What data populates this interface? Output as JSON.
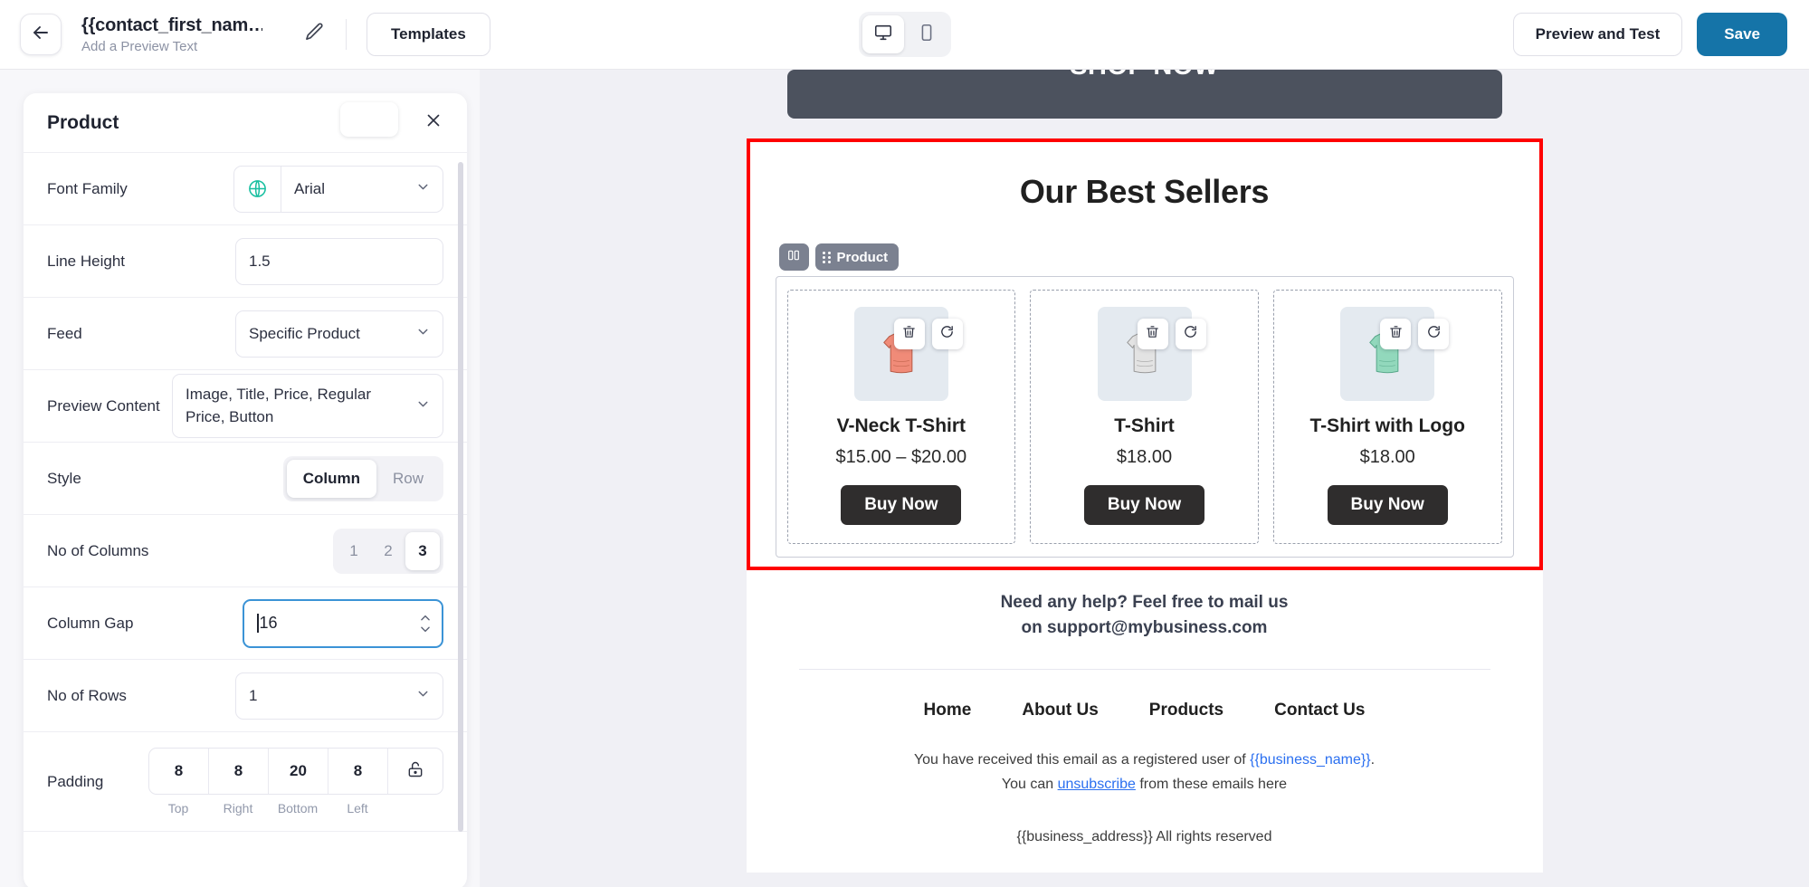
{
  "topbar": {
    "back_icon": "arrow-left-icon",
    "subject": "{{contact_first_nam…",
    "preview_text": "Add a Preview Text",
    "edit_icon": "pencil-icon",
    "templates_label": "Templates",
    "desktop_icon": "desktop-icon",
    "mobile_icon": "mobile-icon",
    "preview_label": "Preview and Test",
    "save_label": "Save",
    "save_color": "#1574a8"
  },
  "panel": {
    "title": "Product",
    "close_icon": "close-icon",
    "rows": {
      "font_family": {
        "label": "Font Family",
        "icon": "globe-icon",
        "value": "Arial"
      },
      "line_height": {
        "label": "Line Height",
        "value": "1.5"
      },
      "feed": {
        "label": "Feed",
        "value": "Specific Product"
      },
      "preview_content": {
        "label": "Preview Content",
        "value": "Image, Title, Price, Regular Price, Button"
      },
      "style": {
        "label": "Style",
        "options": [
          "Column",
          "Row"
        ],
        "selected": "Column"
      },
      "no_of_columns": {
        "label": "No of Columns",
        "options": [
          "1",
          "2",
          "3"
        ],
        "selected": "3"
      },
      "column_gap": {
        "label": "Column Gap",
        "value": "16"
      },
      "no_of_rows": {
        "label": "No of Rows",
        "value": "1"
      },
      "padding": {
        "label": "Padding",
        "values": [
          "8",
          "8",
          "20",
          "8"
        ],
        "labels": [
          "Top",
          "Right",
          "Bottom",
          "Left"
        ],
        "lock_icon": "unlock-icon"
      }
    }
  },
  "email": {
    "hero_button": "SHOP NOW",
    "section_title": "Our Best Sellers",
    "block_badge": "Product",
    "block_columns_icon": "columns-icon",
    "block_drag_icon": "drag-handle-icon",
    "selection_color": "#ff0000",
    "products": [
      {
        "name": "V-Neck T-Shirt",
        "price": "$15.00 – $20.00",
        "button": "Buy Now",
        "image": "tshirt-salmon",
        "delete_icon": "trash-icon",
        "refresh_icon": "refresh-icon"
      },
      {
        "name": "T-Shirt",
        "price": "$18.00",
        "button": "Buy Now",
        "image": "tshirt-grey",
        "delete_icon": "trash-icon",
        "refresh_icon": "refresh-icon"
      },
      {
        "name": "T-Shirt with Logo",
        "price": "$18.00",
        "button": "Buy Now",
        "image": "tshirt-mint",
        "delete_icon": "trash-icon",
        "refresh_icon": "refresh-icon"
      }
    ],
    "help_line1": "Need any help? Feel free to mail us",
    "help_line2": "on support@mybusiness.com",
    "footer_nav": [
      "Home",
      "About Us",
      "Products",
      "Contact Us"
    ],
    "legal_pre": "You have received this email as a registered user of ",
    "legal_merge": "{{business_name}}",
    "legal_post": ".",
    "unsub_pre": "You can ",
    "unsub_link": "unsubscribe",
    "unsub_post": " from these emails here",
    "copyright": "{{business_address}} All rights reserved"
  }
}
